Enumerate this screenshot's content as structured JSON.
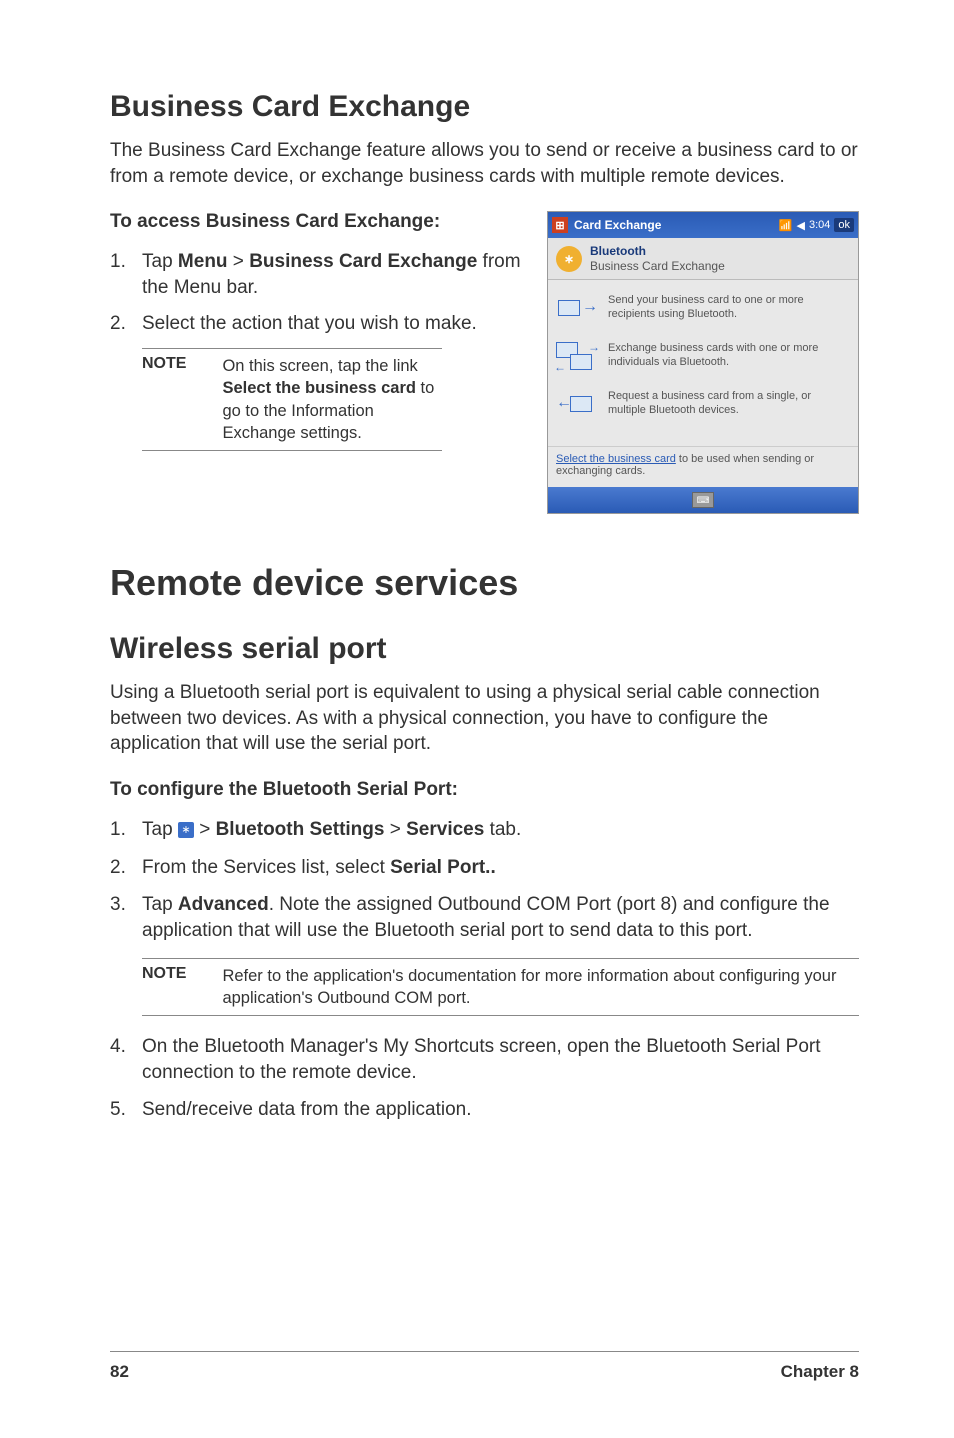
{
  "h2_1": "Business Card Exchange",
  "p1": "The Business Card Exchange feature allows you to send or receive a business card to or from a remote device, or exchange business cards with multiple remote devices.",
  "sub1": "To access Business Card Exchange:",
  "list1": {
    "i1_num": "1.",
    "i1_pre": "Tap ",
    "i1_b1": "Menu",
    "i1_mid": " > ",
    "i1_b2": "Business Card Exchange",
    "i1_post": " from the Menu bar.",
    "i2_num": "2.",
    "i2_txt": "Select the action that you wish to make."
  },
  "note1": {
    "label": "NOTE",
    "pre": "On this screen, tap the link ",
    "bold": "Select the business card",
    "post": " to go to the Information Exchange settings."
  },
  "h1_1": "Remote device services",
  "h2_2": "Wireless serial port",
  "p2": "Using a Bluetooth serial port is equivalent to using a physical serial cable connection between two devices. As with a physical connection, you have to configure the application that will use the serial port.",
  "sub2": "To configure the Bluetooth Serial Port:",
  "list2": {
    "i1_num": "1.",
    "i1_pre": "Tap ",
    "i1_mid1": " > ",
    "i1_b1": "Bluetooth Settings",
    "i1_mid2": " > ",
    "i1_b2": "Services",
    "i1_post": " tab.",
    "i2_num": "2.",
    "i2_pre": "From the Services list, select ",
    "i2_b1": "Serial Port..",
    "i3_num": "3.",
    "i3_pre": "Tap ",
    "i3_b1": "Advanced",
    "i3_post": ". Note the assigned Outbound COM Port  (port 8) and configure the application that will use the Bluetooth serial port to send data to this port.",
    "i4_num": "4.",
    "i4_txt": "On the Bluetooth Manager's My Shortcuts screen, open the Bluetooth Serial Port connection to the remote device.",
    "i5_num": "5.",
    "i5_txt": "Send/receive data from the application."
  },
  "note2": {
    "label": "NOTE",
    "text": "Refer to the application's documentation for more information about configuring your application's Outbound COM port."
  },
  "screenshot": {
    "titlebar": "Card Exchange",
    "time": "3:04",
    "ok": "ok",
    "header_title": "Bluetooth",
    "header_sub": "Business Card Exchange",
    "item1": "Send your business card to one or more recipients using Bluetooth.",
    "item2": "Exchange business cards with one or more individuals via Bluetooth.",
    "item3": "Request a business card from a single, or multiple Bluetooth devices.",
    "footer_link": "Select the business card",
    "footer_rest": " to be used when sending or exchanging cards."
  },
  "footer": {
    "page": "82",
    "chapter": "Chapter 8"
  },
  "bt_glyph": "∗"
}
